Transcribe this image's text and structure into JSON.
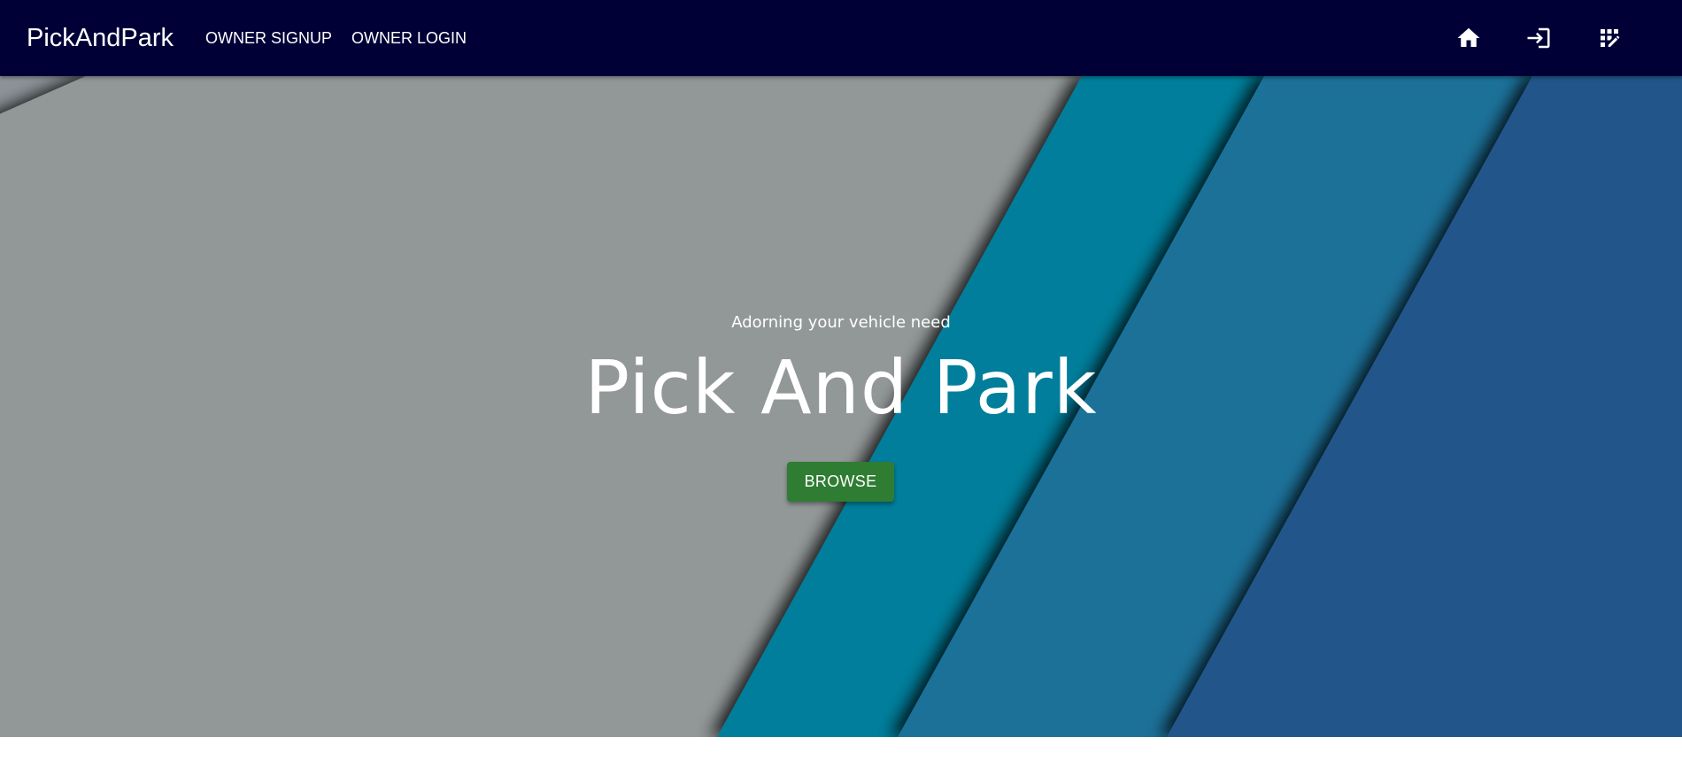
{
  "navbar": {
    "brand": "PickAndPark",
    "links": [
      {
        "label": "OWNER SIGNUP"
      },
      {
        "label": "OWNER LOGIN"
      }
    ],
    "icons": [
      "home-icon",
      "login-icon",
      "app-registration-icon"
    ]
  },
  "hero": {
    "tagline": "Adorning your vehicle need",
    "title": "Pick And Park",
    "browse_label": "BROWSE"
  },
  "colors": {
    "navbar": "#000037",
    "hero_gray": "#929798",
    "teal": "#007e9b",
    "steel_blue": "#1a7199",
    "navy_blue": "#23568a",
    "button_green": "#2e7d32"
  }
}
